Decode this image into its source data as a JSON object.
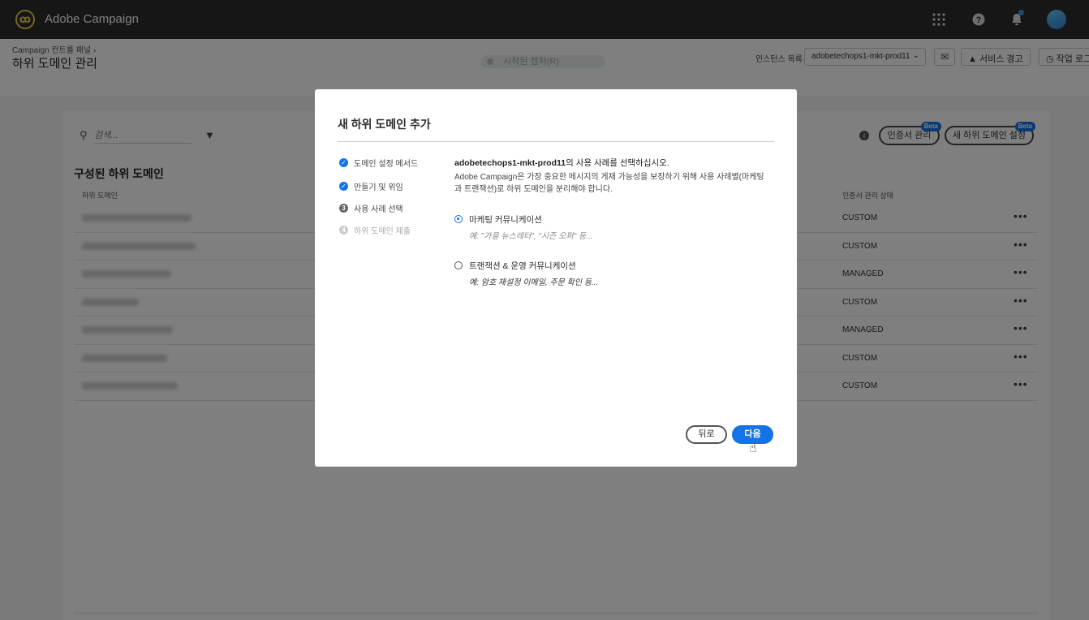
{
  "app": {
    "name": "Adobe Campaign",
    "logo_glyph": "ꝏ"
  },
  "topbar": {
    "grid_icon": "apps-grid-icon",
    "help_icon": "help-icon",
    "bell_icon": "bell-icon",
    "notification_color": "#2d9bf0"
  },
  "header": {
    "breadcrumb": "Campaign 컨트롤 패널  ›",
    "title": "하위 도메인 관리",
    "status_pill": "시작된 캡처(R)",
    "instance_label": "인스턴스 목록",
    "instance_value": "adobetechops1-mkt-prod11",
    "service_warning": "서비스 경고",
    "job_log": "작업 로그"
  },
  "panel": {
    "search_placeholder": "검색...",
    "cert_button": "인증서 관리",
    "new_subdomain_button": "새 하위 도메인 설정",
    "beta_badge": "Beta",
    "section_title": "구성된 하위 도메인",
    "col_subdomain": "하위 도메인",
    "col_cert_status": "인증서 관리 상태",
    "rows": [
      {
        "cert_status": "CUSTOM"
      },
      {
        "cert_status": "CUSTOM"
      },
      {
        "cert_status": "MANAGED"
      },
      {
        "cert_status": "CUSTOM"
      },
      {
        "cert_status": "MANAGED"
      },
      {
        "cert_status": "CUSTOM"
      },
      {
        "cert_status": "CUSTOM"
      }
    ]
  },
  "dialog": {
    "title": "새 하위 도메인 추가",
    "steps": [
      {
        "label": "도메인 설정 메서드",
        "state": "done"
      },
      {
        "label": "만들기 및 위임",
        "state": "done"
      },
      {
        "label": "사용 사례 선택",
        "state": "current",
        "number": "3"
      },
      {
        "label": "하위 도메인 제출",
        "state": "todo",
        "number": "4"
      }
    ],
    "heading_instance": "adobetechops1-mkt-prod11",
    "heading_rest": "의 사용 사례를 선택하십시오.",
    "description": "Adobe Campaign은 가장 중요한 메시지의 게재 가능성을 보장하기 위해 사용 사례별(마케팅과 트랜잭션)로 하위 도메인을 분리해야 합니다.",
    "options": [
      {
        "label": "마케팅 커뮤니케이션",
        "example": "예: \"가을 뉴스레터\", \"시즌 오퍼\" 등...",
        "checked": true
      },
      {
        "label": "트랜잭션 & 운영 커뮤니케이션",
        "example": "예: 암호 재설정 이메일, 주문 확인 등...",
        "checked": false
      }
    ],
    "back_button": "뒤로",
    "next_button": "다음",
    "accent_color": "#1473e6"
  }
}
